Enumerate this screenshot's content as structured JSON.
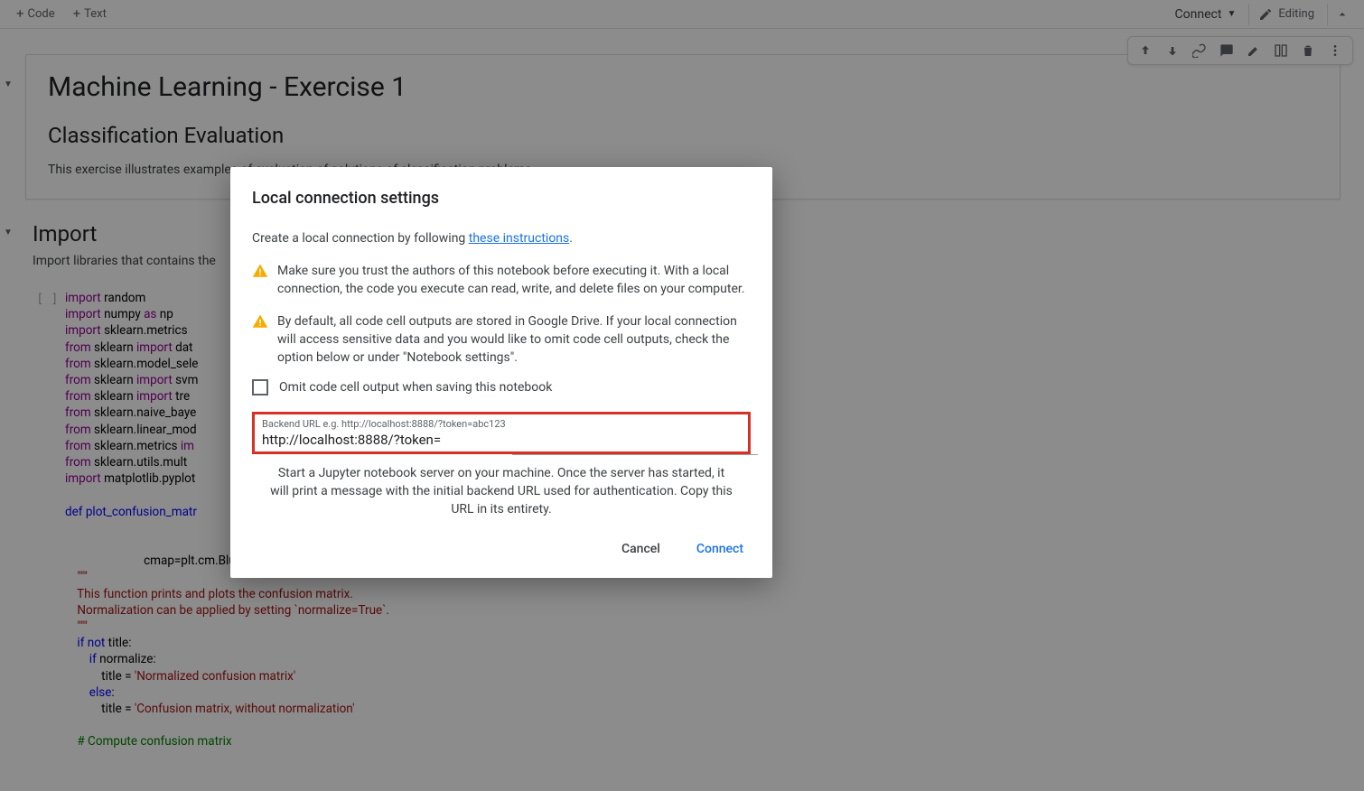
{
  "toolbar": {
    "code_btn": "Code",
    "text_btn": "Text",
    "connect_btn": "Connect",
    "editing_btn": "Editing"
  },
  "document": {
    "title": "Machine Learning - Exercise 1",
    "subtitle": "Classification Evaluation",
    "intro": "This exercise illustrates examples of evaluation of solutions of classification problems.",
    "import_heading": "Import",
    "import_text": "Import libraries that contains the",
    "gutter": "[ ]"
  },
  "code_lines": [
    {
      "tokens": [
        {
          "t": "import ",
          "c": "kw-purple"
        },
        {
          "t": "random"
        }
      ]
    },
    {
      "tokens": [
        {
          "t": "import ",
          "c": "kw-purple"
        },
        {
          "t": "numpy "
        },
        {
          "t": "as ",
          "c": "kw-purple"
        },
        {
          "t": "np"
        }
      ]
    },
    {
      "tokens": [
        {
          "t": "import ",
          "c": "kw-purple"
        },
        {
          "t": "sklearn.metrics"
        }
      ]
    },
    {
      "tokens": [
        {
          "t": "from ",
          "c": "kw-purple"
        },
        {
          "t": "sklearn "
        },
        {
          "t": "import ",
          "c": "kw-purple"
        },
        {
          "t": "dat"
        }
      ]
    },
    {
      "tokens": [
        {
          "t": "from ",
          "c": "kw-purple"
        },
        {
          "t": "sklearn.model_sele"
        }
      ]
    },
    {
      "tokens": [
        {
          "t": "from ",
          "c": "kw-purple"
        },
        {
          "t": "sklearn "
        },
        {
          "t": "import ",
          "c": "kw-purple"
        },
        {
          "t": "svm"
        }
      ]
    },
    {
      "tokens": [
        {
          "t": "from ",
          "c": "kw-purple"
        },
        {
          "t": "sklearn "
        },
        {
          "t": "import ",
          "c": "kw-purple"
        },
        {
          "t": "tre"
        }
      ]
    },
    {
      "tokens": [
        {
          "t": "from ",
          "c": "kw-purple"
        },
        {
          "t": "sklearn.naive_baye"
        }
      ]
    },
    {
      "tokens": [
        {
          "t": "from ",
          "c": "kw-purple"
        },
        {
          "t": "sklearn.linear_mod"
        }
      ]
    },
    {
      "tokens": [
        {
          "t": "from ",
          "c": "kw-purple"
        },
        {
          "t": "sklearn.metrics "
        },
        {
          "t": "im",
          "c": "kw-purple"
        }
      ]
    },
    {
      "tokens": [
        {
          "t": "from ",
          "c": "kw-purple"
        },
        {
          "t": "sklearn.utils.mult"
        }
      ]
    },
    {
      "tokens": [
        {
          "t": "import ",
          "c": "kw-purple"
        },
        {
          "t": "matplotlib.pyplot"
        }
      ]
    },
    {
      "tokens": [
        {
          "t": ""
        }
      ]
    },
    {
      "tokens": [
        {
          "t": "def ",
          "c": "kw-blue"
        },
        {
          "t": "plot_confusion_matr",
          "c": "fn-blue"
        }
      ]
    },
    {
      "tokens": [
        {
          "t": ""
        }
      ]
    },
    {
      "tokens": [
        {
          "t": ""
        }
      ]
    },
    {
      "tokens": [
        {
          "t": "                          cmap=plt.cm.Blues):"
        }
      ]
    },
    {
      "tokens": [
        {
          "t": "    \"\"\"",
          "c": "str-red"
        }
      ]
    },
    {
      "tokens": [
        {
          "t": "    This function prints and plots the confusion matrix.",
          "c": "str-red"
        }
      ]
    },
    {
      "tokens": [
        {
          "t": "    Normalization can be applied by setting `normalize=True`.",
          "c": "str-red"
        }
      ]
    },
    {
      "tokens": [
        {
          "t": "    \"\"\"",
          "c": "str-red"
        }
      ]
    },
    {
      "tokens": [
        {
          "t": "    "
        },
        {
          "t": "if ",
          "c": "kw-blue"
        },
        {
          "t": "not ",
          "c": "kw-blue"
        },
        {
          "t": "title:"
        }
      ]
    },
    {
      "tokens": [
        {
          "t": "        "
        },
        {
          "t": "if ",
          "c": "kw-blue"
        },
        {
          "t": "normalize:"
        }
      ]
    },
    {
      "tokens": [
        {
          "t": "            title = "
        },
        {
          "t": "'Normalized confusion matrix'",
          "c": "str-red"
        }
      ]
    },
    {
      "tokens": [
        {
          "t": "        "
        },
        {
          "t": "else",
          "c": "kw-blue"
        },
        {
          "t": ":"
        }
      ]
    },
    {
      "tokens": [
        {
          "t": "            title = "
        },
        {
          "t": "'Confusion matrix, without normalization'",
          "c": "str-red"
        }
      ]
    },
    {
      "tokens": [
        {
          "t": ""
        }
      ]
    },
    {
      "tokens": [
        {
          "t": "    # Compute confusion matrix",
          "c": "comment"
        }
      ]
    }
  ],
  "dialog": {
    "title": "Local connection settings",
    "intro_pre": "Create a local connection by following ",
    "intro_link": "these instructions",
    "intro_post": ".",
    "warn1": "Make sure you trust the authors of this notebook before executing it. With a local connection, the code you execute can read, write, and delete files on your computer.",
    "warn2": "By default, all code cell outputs are stored in Google Drive. If your local connection will access sensitive data and you would like to omit code cell outputs, check the option below or under \"Notebook settings\".",
    "checkbox_label": "Omit code cell output when saving this notebook",
    "input_label": "Backend URL e.g. http://localhost:8888/?token=abc123",
    "input_value": "http://localhost:8888/?token=",
    "helper": "Start a Jupyter notebook server on your machine. Once the server has started, it will print a message with the initial backend URL used for authentication. Copy this URL in its entirety.",
    "cancel": "Cancel",
    "connect": "Connect"
  }
}
